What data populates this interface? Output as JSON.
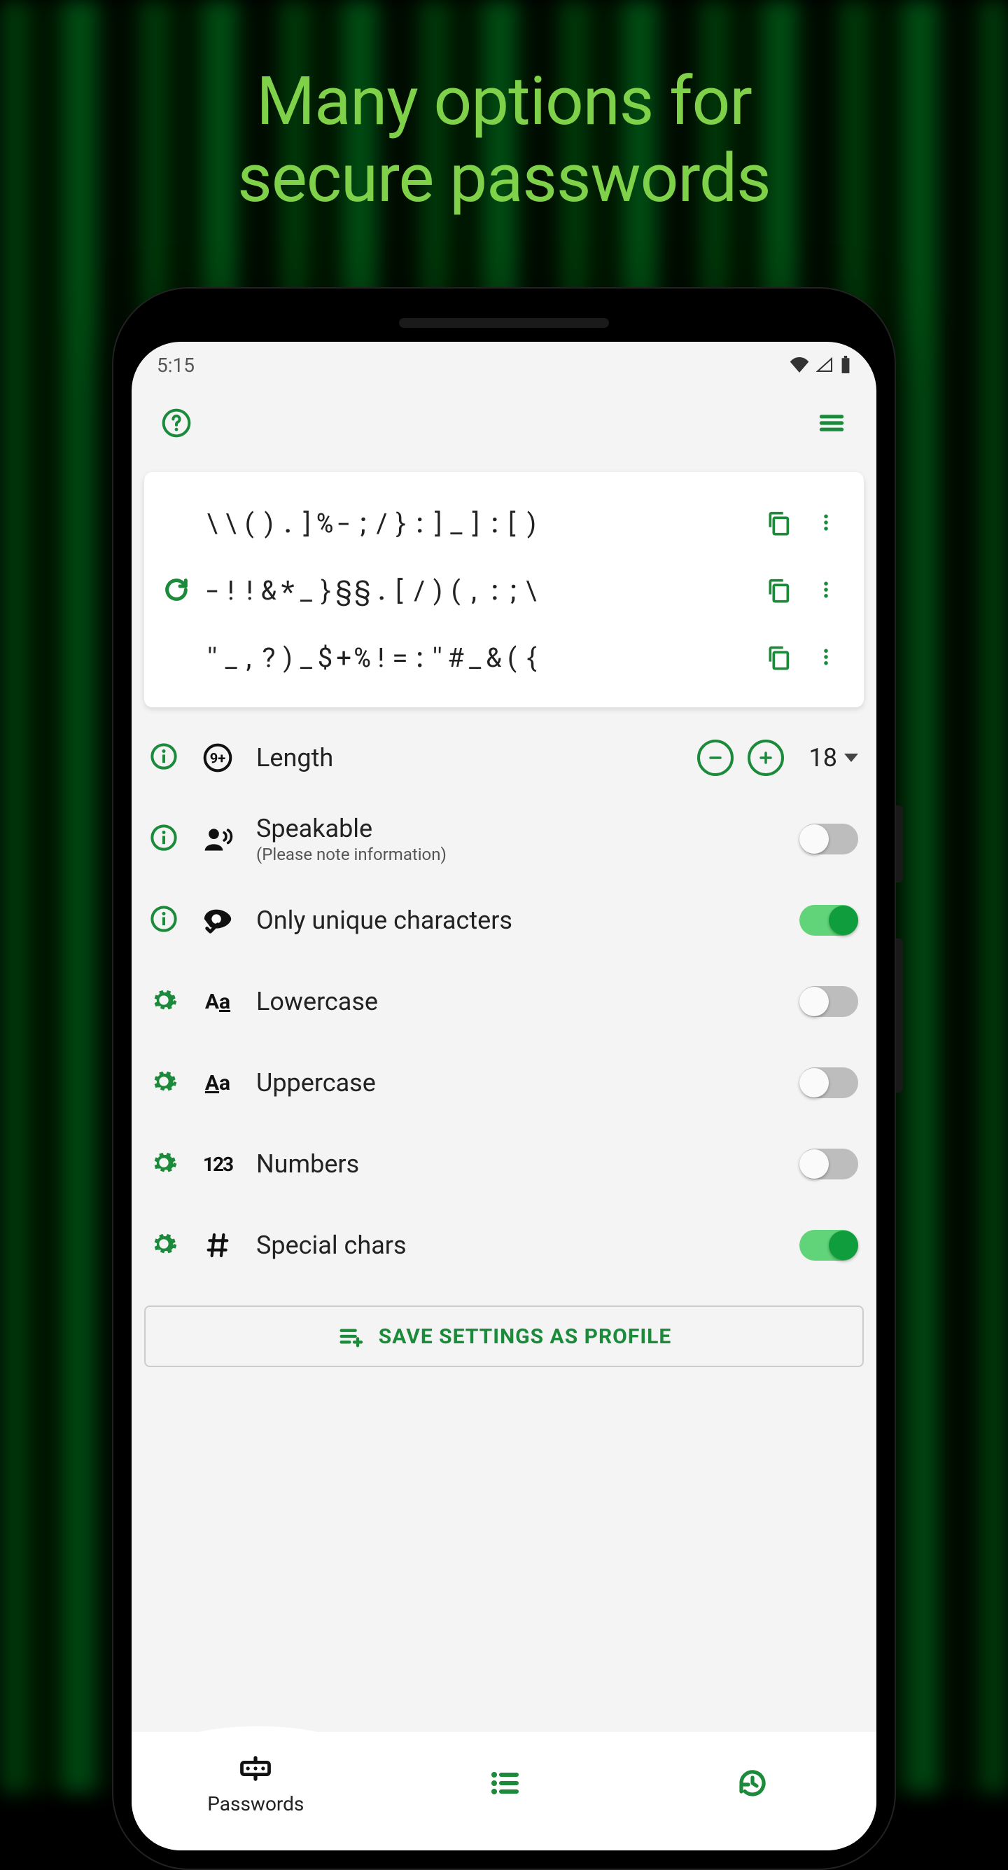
{
  "headline_line1": "Many options for",
  "headline_line2": "secure passwords",
  "statusbar": {
    "time": "5:15"
  },
  "passwords": [
    "\\\\().]%-;/}:]_]:[)",
    "-!!&*_}§§.[/)(,:;\\",
    "\"_,?)_$+%!=:\"#_&({"
  ],
  "options": {
    "length": {
      "label": "Length",
      "value": "18"
    },
    "speakable": {
      "label": "Speakable",
      "sub": "(Please note information)",
      "on": false
    },
    "unique": {
      "label": "Only unique characters",
      "on": true
    },
    "lowercase": {
      "label": "Lowercase",
      "on": false
    },
    "uppercase": {
      "label": "Uppercase",
      "on": false
    },
    "numbers": {
      "label": "Numbers",
      "on": false
    },
    "special": {
      "label": "Special chars",
      "on": true
    }
  },
  "save_profile_label": "SAVE SETTINGS AS PROFILE",
  "bottomnav": {
    "passwords": "Passwords"
  }
}
